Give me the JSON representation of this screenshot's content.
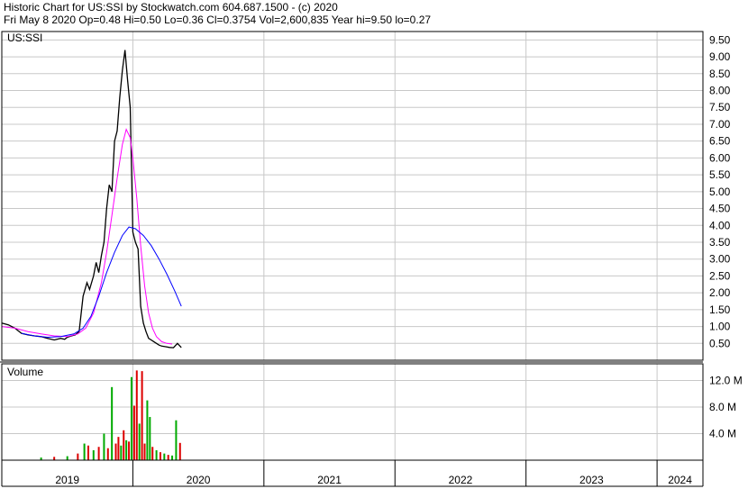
{
  "header": {
    "line1": "Historic Chart for US:SSI by Stockwatch.com 604.687.1500 - (c) 2020",
    "line2": "Fri May  8 2020  Op=0.48  Hi=0.50  Lo=0.36  Cl=0.3754  Vol=2,600,835  Year hi=9.50  lo=0.27"
  },
  "colors": {
    "background": "#ffffff",
    "grid": "#c8c8c8",
    "price": "#000000",
    "ma_short": "#ff00ff",
    "ma_long": "#0000ff",
    "vol_up": "#00aa00",
    "vol_down": "#dd0000",
    "frame": "#000000"
  },
  "chart_data": [
    {
      "type": "line",
      "title": "US:SSI",
      "y_ticks": [
        "9.50",
        "9.00",
        "8.50",
        "8.00",
        "7.50",
        "7.00",
        "6.50",
        "6.00",
        "5.50",
        "5.00",
        "4.50",
        "4.00",
        "3.50",
        "3.00",
        "2.50",
        "2.00",
        "1.50",
        "1.00",
        "0.50"
      ],
      "ylim": [
        0.0,
        9.75
      ],
      "x_ticks": [
        "2019",
        "2020",
        "2021",
        "2022",
        "2023",
        "2024"
      ],
      "x_range": [
        2019.0,
        2024.35
      ],
      "grid": true,
      "series": [
        {
          "role": "price",
          "x": [
            2019.0,
            2019.05,
            2019.1,
            2019.15,
            2019.2,
            2019.25,
            2019.3,
            2019.35,
            2019.4,
            2019.45,
            2019.48,
            2019.5,
            2019.53,
            2019.56,
            2019.59,
            2019.62,
            2019.65,
            2019.67,
            2019.7,
            2019.72,
            2019.74,
            2019.76,
            2019.78,
            2019.8,
            2019.82,
            2019.84,
            2019.86,
            2019.88,
            2019.9,
            2019.92,
            2019.94,
            2019.96,
            2019.98,
            2020.0,
            2020.02,
            2020.04,
            2020.06,
            2020.08,
            2020.1,
            2020.12,
            2020.14,
            2020.16,
            2020.18,
            2020.2,
            2020.22,
            2020.25,
            2020.28,
            2020.31,
            2020.34,
            2020.37
          ],
          "y": [
            1.1,
            1.05,
            0.95,
            0.8,
            0.75,
            0.72,
            0.7,
            0.65,
            0.6,
            0.65,
            0.62,
            0.68,
            0.72,
            0.75,
            0.85,
            1.9,
            2.3,
            2.1,
            2.5,
            2.9,
            2.6,
            3.1,
            3.5,
            4.5,
            5.2,
            5.0,
            6.5,
            6.8,
            7.8,
            8.6,
            9.2,
            8.3,
            7.5,
            3.8,
            3.5,
            3.3,
            1.6,
            1.1,
            0.85,
            0.65,
            0.6,
            0.55,
            0.5,
            0.45,
            0.42,
            0.4,
            0.38,
            0.37,
            0.5,
            0.3754
          ]
        },
        {
          "role": "moving_average_short",
          "x": [
            2019.0,
            2019.1,
            2019.2,
            2019.3,
            2019.4,
            2019.5,
            2019.58,
            2019.64,
            2019.7,
            2019.76,
            2019.8,
            2019.84,
            2019.88,
            2019.92,
            2019.95,
            2019.98,
            2020.0,
            2020.03,
            2020.06,
            2020.09,
            2020.12,
            2020.15,
            2020.18,
            2020.22,
            2020.26,
            2020.3
          ],
          "y": [
            1.0,
            0.95,
            0.85,
            0.78,
            0.72,
            0.7,
            0.78,
            0.95,
            1.4,
            2.3,
            3.2,
            4.3,
            5.4,
            6.4,
            6.85,
            6.6,
            6.0,
            4.8,
            3.4,
            2.2,
            1.4,
            0.95,
            0.7,
            0.55,
            0.5,
            0.48
          ]
        },
        {
          "role": "moving_average_long",
          "x": [
            2019.15,
            2019.25,
            2019.35,
            2019.45,
            2019.55,
            2019.62,
            2019.68,
            2019.74,
            2019.8,
            2019.86,
            2019.92,
            2019.97,
            2020.02,
            2020.08,
            2020.14,
            2020.2,
            2020.26,
            2020.32,
            2020.37
          ],
          "y": [
            0.8,
            0.72,
            0.68,
            0.7,
            0.78,
            0.95,
            1.3,
            1.9,
            2.6,
            3.2,
            3.7,
            3.95,
            3.9,
            3.7,
            3.4,
            3.0,
            2.55,
            2.05,
            1.6
          ]
        }
      ]
    },
    {
      "type": "bar",
      "title": "Volume",
      "y_ticks": [
        "12.0 M",
        "8.0 M",
        "4.0 M"
      ],
      "ylim": [
        0,
        14.5
      ],
      "x_range": [
        2019.0,
        2024.35
      ],
      "bars": [
        {
          "x": 2019.3,
          "v": 0.4,
          "c": "up"
        },
        {
          "x": 2019.4,
          "v": 0.5,
          "c": "down"
        },
        {
          "x": 2019.5,
          "v": 0.6,
          "c": "up"
        },
        {
          "x": 2019.58,
          "v": 1.0,
          "c": "down"
        },
        {
          "x": 2019.63,
          "v": 2.5,
          "c": "up"
        },
        {
          "x": 2019.66,
          "v": 2.2,
          "c": "down"
        },
        {
          "x": 2019.7,
          "v": 1.5,
          "c": "up"
        },
        {
          "x": 2019.74,
          "v": 2.0,
          "c": "down"
        },
        {
          "x": 2019.78,
          "v": 4.0,
          "c": "up"
        },
        {
          "x": 2019.81,
          "v": 1.8,
          "c": "down"
        },
        {
          "x": 2019.84,
          "v": 11.0,
          "c": "up"
        },
        {
          "x": 2019.87,
          "v": 2.5,
          "c": "down"
        },
        {
          "x": 2019.89,
          "v": 3.5,
          "c": "down"
        },
        {
          "x": 2019.91,
          "v": 2.2,
          "c": "up"
        },
        {
          "x": 2019.93,
          "v": 4.5,
          "c": "down"
        },
        {
          "x": 2019.95,
          "v": 3.0,
          "c": "up"
        },
        {
          "x": 2019.97,
          "v": 2.8,
          "c": "down"
        },
        {
          "x": 2019.99,
          "v": 12.5,
          "c": "up"
        },
        {
          "x": 2020.01,
          "v": 8.2,
          "c": "down"
        },
        {
          "x": 2020.03,
          "v": 13.5,
          "c": "down"
        },
        {
          "x": 2020.05,
          "v": 5.5,
          "c": "up"
        },
        {
          "x": 2020.07,
          "v": 13.4,
          "c": "down"
        },
        {
          "x": 2020.09,
          "v": 2.5,
          "c": "down"
        },
        {
          "x": 2020.11,
          "v": 9.0,
          "c": "up"
        },
        {
          "x": 2020.13,
          "v": 6.5,
          "c": "up"
        },
        {
          "x": 2020.15,
          "v": 2.0,
          "c": "down"
        },
        {
          "x": 2020.18,
          "v": 1.5,
          "c": "up"
        },
        {
          "x": 2020.21,
          "v": 1.2,
          "c": "down"
        },
        {
          "x": 2020.24,
          "v": 1.0,
          "c": "up"
        },
        {
          "x": 2020.27,
          "v": 0.8,
          "c": "down"
        },
        {
          "x": 2020.3,
          "v": 0.7,
          "c": "up"
        },
        {
          "x": 2020.33,
          "v": 6.0,
          "c": "up"
        },
        {
          "x": 2020.36,
          "v": 2.6,
          "c": "down"
        }
      ]
    }
  ]
}
